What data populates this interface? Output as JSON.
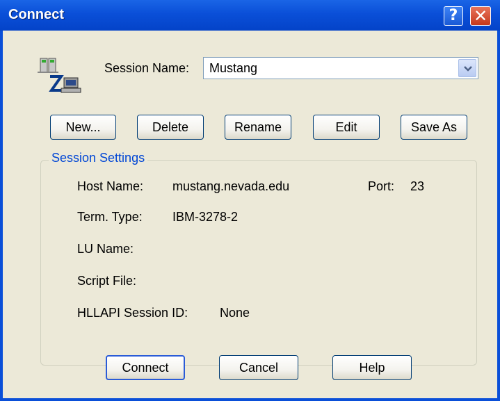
{
  "window": {
    "title": "Connect",
    "help_glyph": "?",
    "close_glyph": "✕"
  },
  "session": {
    "label": "Session Name:",
    "value": "Mustang"
  },
  "actions": {
    "new": "New...",
    "delete": "Delete",
    "rename": "Rename",
    "edit": "Edit",
    "save_as": "Save As"
  },
  "settings": {
    "legend": "Session Settings",
    "host_label": "Host Name:",
    "host_value": "mustang.nevada.edu",
    "port_label": "Port:",
    "port_value": "23",
    "term_label": "Term. Type:",
    "term_value": "IBM-3278-2",
    "lu_label": "LU Name:",
    "lu_value": "",
    "script_label": "Script File:",
    "script_value": "",
    "hllapi_label": "HLLAPI Session ID:",
    "hllapi_value": "None"
  },
  "footer": {
    "connect": "Connect",
    "cancel": "Cancel",
    "help": "Help"
  },
  "colors": {
    "titlebar": "#0a4fd8",
    "dialog_bg": "#ece9d8",
    "group_legend": "#0046d5",
    "close_button": "#c6391c"
  },
  "icons": {
    "session": "session-computer-icon",
    "dropdown": "chevron-down-icon"
  }
}
